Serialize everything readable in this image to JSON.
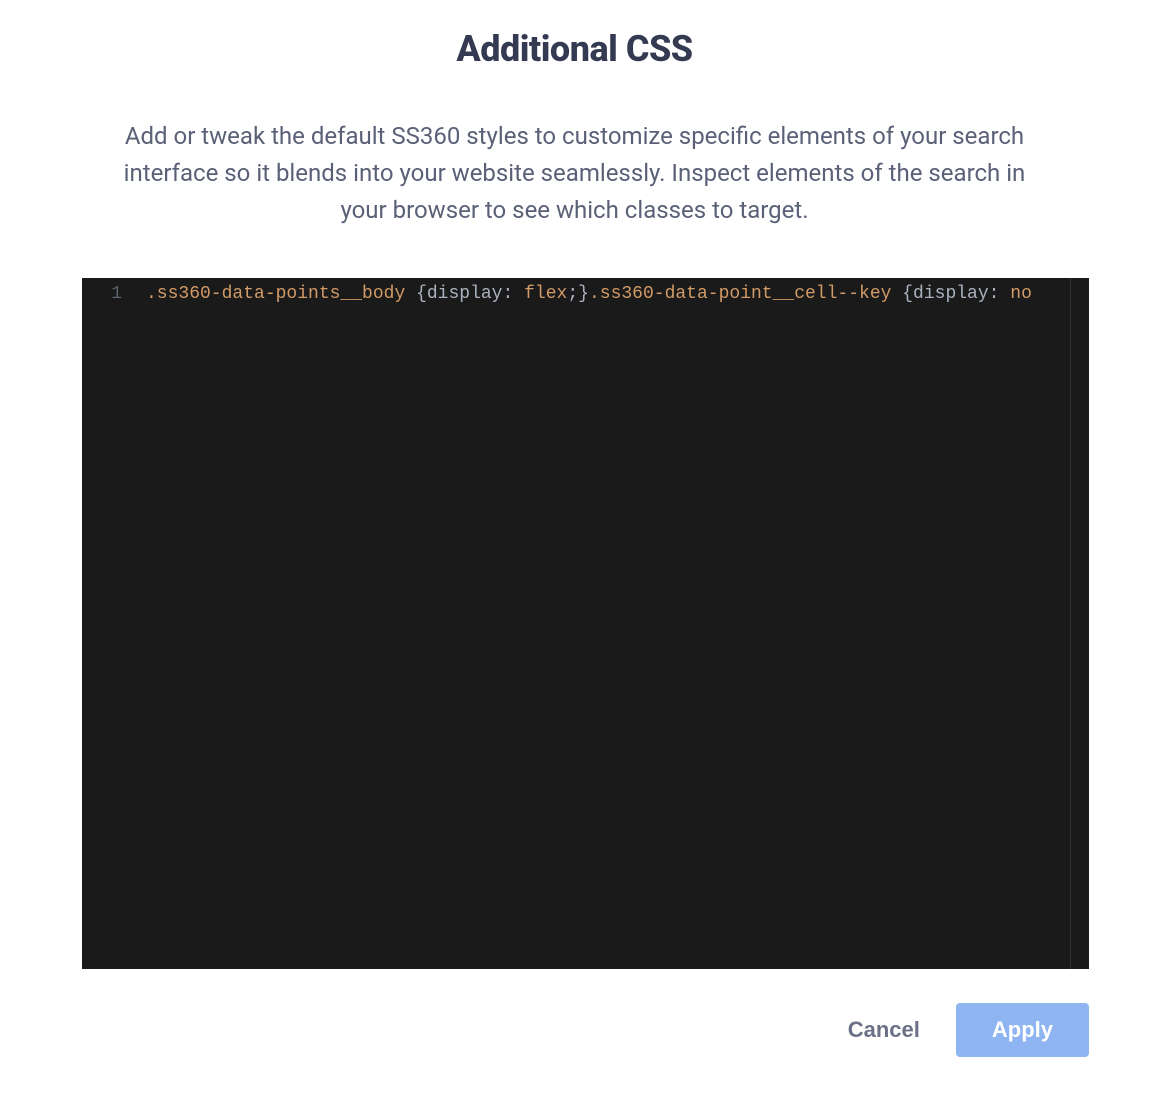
{
  "title": "Additional CSS",
  "description": "Add or tweak the default SS360 styles to customize specific elements of your search interface so it blends into your website seamlessly. Inspect elements of the search in your browser to see which classes to target.",
  "editor": {
    "lineNumber": "1",
    "tokens": [
      {
        "cls": "tok-selector",
        "text": ".ss360-data-points__body"
      },
      {
        "cls": "tok-space",
        "text": " "
      },
      {
        "cls": "tok-brace",
        "text": "{"
      },
      {
        "cls": "tok-prop",
        "text": "display"
      },
      {
        "cls": "tok-colon",
        "text": ":"
      },
      {
        "cls": "tok-space",
        "text": " "
      },
      {
        "cls": "tok-value",
        "text": "flex"
      },
      {
        "cls": "tok-semicolon",
        "text": ";"
      },
      {
        "cls": "tok-brace",
        "text": "}"
      },
      {
        "cls": "tok-selector",
        "text": ".ss360-data-point__cell--key"
      },
      {
        "cls": "tok-space",
        "text": " "
      },
      {
        "cls": "tok-brace",
        "text": "{"
      },
      {
        "cls": "tok-prop",
        "text": "display"
      },
      {
        "cls": "tok-colon",
        "text": ":"
      },
      {
        "cls": "tok-space",
        "text": " "
      },
      {
        "cls": "tok-value",
        "text": "no"
      }
    ]
  },
  "buttons": {
    "cancel": "Cancel",
    "apply": "Apply"
  }
}
